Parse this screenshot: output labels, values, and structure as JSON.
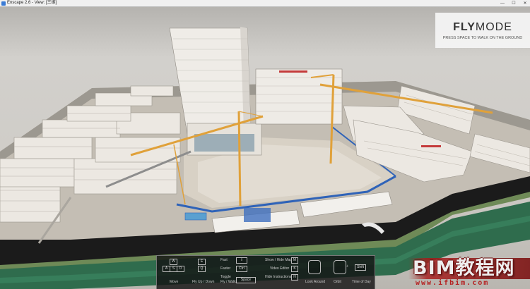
{
  "window": {
    "title": "Enscape 2.6 - View: [三维]",
    "minimize": "—",
    "maximize": "☐",
    "close": "✕"
  },
  "overlay": {
    "mode_bold": "FLY",
    "mode_regular": "MODE",
    "hint": "PRESS SPACE TO WALK ON THE GROUND"
  },
  "controls": {
    "keys": {
      "w": "W",
      "a": "A",
      "s": "S",
      "d": "D",
      "q": "Q",
      "e": "E",
      "shift": "⇧",
      "ctrl": "Ctrl",
      "space": "Space",
      "m": "M",
      "k": "K",
      "h": "H",
      "u": "U",
      "shift_time": "Shift"
    },
    "labels": {
      "move": "Move",
      "fly_up_down": "Fly Up / Down",
      "fast": "Fast",
      "faster": "Faster",
      "toggle": "Toggle",
      "fly_walk": "Fly / Walk",
      "show_hide_map": "Show / Hide Map",
      "video_editor": "Video Editor",
      "hide_instructions": "Hide Instructions",
      "look_around": "Look Around",
      "orbit": "Orbit",
      "time_of_day": "Time of Day",
      "plus": "+"
    }
  },
  "watermark": {
    "text": "BIM教程网",
    "url": "www.ifbim.com"
  },
  "colors": {
    "crane": "#e0a13a",
    "fence_blue": "#2f63b8",
    "river": "#2f6c4d",
    "road": "#1b1b1b"
  }
}
